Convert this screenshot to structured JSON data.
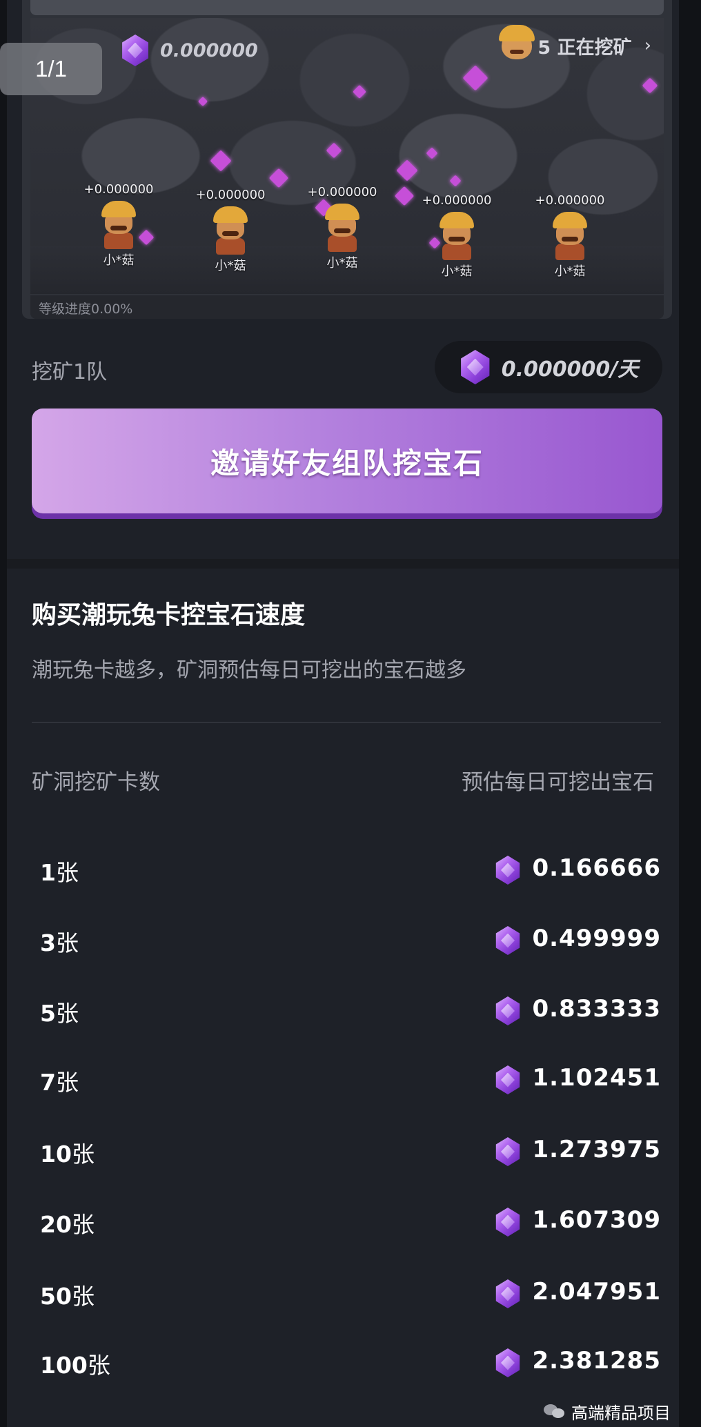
{
  "overlay": {
    "page_counter": "1/1"
  },
  "mine": {
    "gem_total": "0.000000",
    "miners_active": "5 正在挖矿",
    "level_progress": "等级进度0.00%",
    "miners": [
      {
        "earn": "+0.000000",
        "name": "小*菇"
      },
      {
        "earn": "+0.000000",
        "name": "小*菇"
      },
      {
        "earn": "+0.000000",
        "name": "小*菇"
      },
      {
        "earn": "+0.000000",
        "name": "小*菇"
      },
      {
        "earn": "+0.000000",
        "name": "小*菇"
      }
    ]
  },
  "team": {
    "label": "挖矿1队",
    "daily_rate": "0.000000/天",
    "invite_button": "邀请好友组队挖宝石"
  },
  "speed": {
    "title": "购买潮玩兔卡控宝石速度",
    "description": "潮玩兔卡越多，矿洞预估每日可挖出的宝石越多",
    "col_cards": "矿洞挖矿卡数",
    "col_gems": "预估每日可挖出宝石",
    "unit": "张",
    "rows": [
      {
        "cards": "1",
        "gems": "0.166666"
      },
      {
        "cards": "3",
        "gems": "0.499999"
      },
      {
        "cards": "5",
        "gems": "0.833333"
      },
      {
        "cards": "7",
        "gems": "1.102451"
      },
      {
        "cards": "10",
        "gems": "1.273975"
      },
      {
        "cards": "20",
        "gems": "1.607309"
      },
      {
        "cards": "50",
        "gems": "2.047951"
      },
      {
        "cards": "100",
        "gems": "2.381285"
      }
    ]
  },
  "watermark": {
    "text": "高端精品项目",
    "icon": "wechat-icon"
  },
  "colors": {
    "accent_purple": "#9857d0",
    "gem": "#b167f0",
    "background": "#1e2128"
  }
}
